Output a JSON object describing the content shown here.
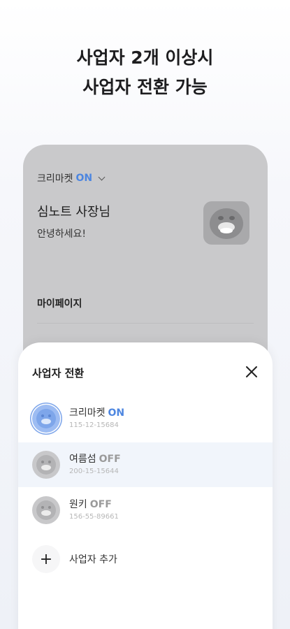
{
  "headline": {
    "line1": "사업자 2개 이상시",
    "line2": "사업자 전환 가능"
  },
  "background_screen": {
    "store_name": "크리마켓",
    "store_status": "ON",
    "owner_title": "심노트 사장님",
    "greeting": "안녕하세요!",
    "menu_mypage": "마이페이지"
  },
  "sheet": {
    "title": "사업자 전환",
    "close_icon": "close-icon",
    "businesses": [
      {
        "name": "크리마켓",
        "status": "ON",
        "number": "115-12-15684",
        "selected": false
      },
      {
        "name": "여름섬",
        "status": "OFF",
        "number": "200-15-15644",
        "selected": true
      },
      {
        "name": "원키",
        "status": "OFF",
        "number": "156-55-89661",
        "selected": false
      }
    ],
    "add_label": "사업자 추가",
    "add_icon": "plus-icon"
  },
  "colors": {
    "accent": "#4d86e0",
    "selected_row": "#f1f5fb",
    "dim_overlay": "#c9c9cb"
  }
}
